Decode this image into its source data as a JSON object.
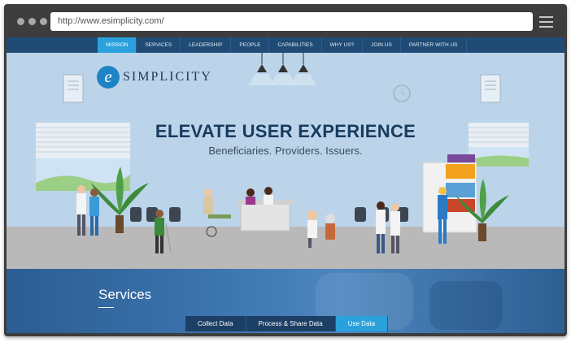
{
  "browser": {
    "url": "http://www.esimplicity.com/"
  },
  "nav": {
    "items": [
      {
        "label": "MISSION",
        "active": true
      },
      {
        "label": "SERVICES",
        "active": false
      },
      {
        "label": "LEADERSHIP",
        "active": false
      },
      {
        "label": "PEOPLE",
        "active": false
      },
      {
        "label": "CAPABILITIES",
        "active": false
      },
      {
        "label": "WHY US?",
        "active": false
      },
      {
        "label": "JOIN US",
        "active": false
      },
      {
        "label": "PARTNER WITH US",
        "active": false
      }
    ]
  },
  "hero": {
    "logo_letter": "e",
    "logo_text": "SIMPLICITY",
    "headline": "ELEVATE USER EXPERIENCE",
    "subline": "Beneficiaries. Providers. Issuers.",
    "carousel_active_index": 1
  },
  "services": {
    "title": "Services",
    "tabs": [
      {
        "label": "Collect Data",
        "active": false
      },
      {
        "label": "Process & Share Data",
        "active": false
      },
      {
        "label": "Use Data",
        "active": true
      }
    ]
  },
  "colors": {
    "nav_bg": "#1f4b75",
    "accent": "#2aa1dc",
    "hero_bg": "#bcd4ea",
    "headline": "#183b5e"
  }
}
